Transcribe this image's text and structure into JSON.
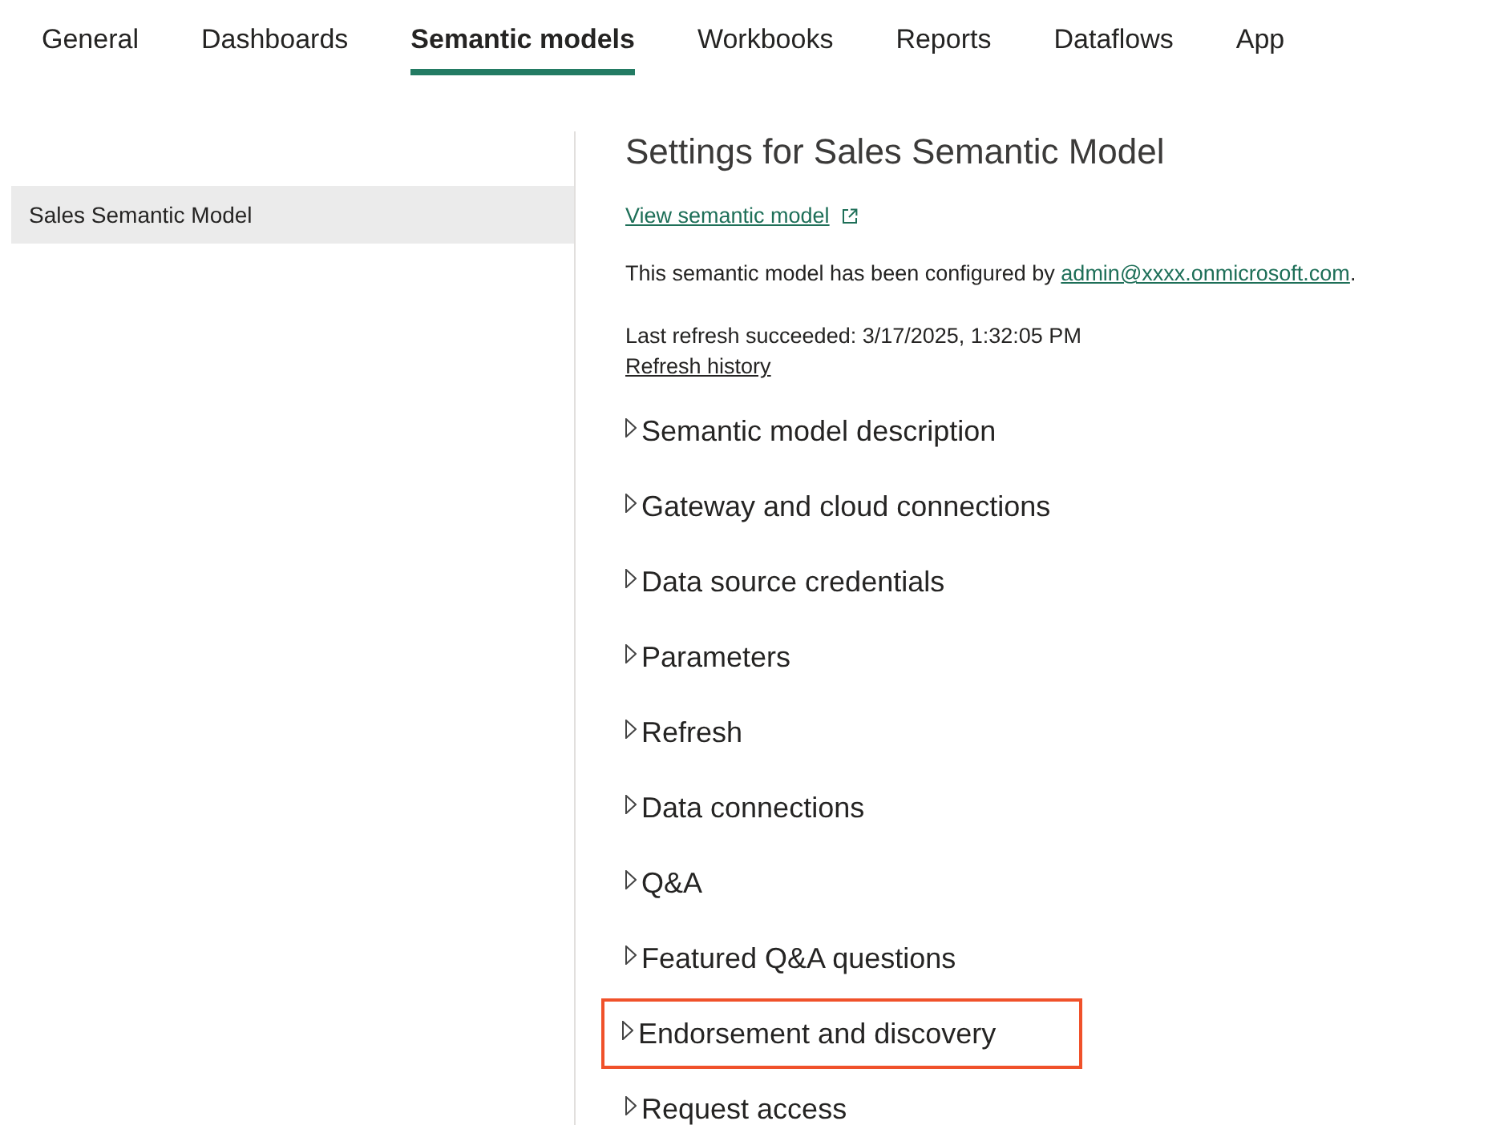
{
  "tabs": [
    {
      "label": "General",
      "selected": false
    },
    {
      "label": "Dashboards",
      "selected": false
    },
    {
      "label": "Semantic models",
      "selected": true
    },
    {
      "label": "Workbooks",
      "selected": false
    },
    {
      "label": "Reports",
      "selected": false
    },
    {
      "label": "Dataflows",
      "selected": false
    },
    {
      "label": "App",
      "selected": false
    }
  ],
  "sidebar": {
    "items": [
      {
        "label": "Sales Semantic Model",
        "selected": true
      }
    ]
  },
  "settings": {
    "title": "Settings for Sales Semantic Model",
    "view_link": "View semantic model",
    "configured_by": {
      "text": "This semantic model has been configured by",
      "email": "admin@xxxx.onmicrosoft.com",
      "suffix": "."
    },
    "last_refresh": "Last refresh succeeded: 3/17/2025, 1:32:05 PM",
    "refresh_history_link": "Refresh history",
    "sections": [
      {
        "label": "Semantic model description",
        "expanded": false,
        "highlighted": false
      },
      {
        "label": "Gateway and cloud connections",
        "expanded": false,
        "highlighted": false
      },
      {
        "label": "Data source credentials",
        "expanded": false,
        "highlighted": false
      },
      {
        "label": "Parameters",
        "expanded": false,
        "highlighted": false
      },
      {
        "label": "Refresh",
        "expanded": false,
        "highlighted": false
      },
      {
        "label": "Data connections",
        "expanded": false,
        "highlighted": false
      },
      {
        "label": "Q&A",
        "expanded": false,
        "highlighted": false
      },
      {
        "label": "Featured Q&A questions",
        "expanded": false,
        "highlighted": false
      },
      {
        "label": "Endorsement and discovery",
        "expanded": false,
        "highlighted": true
      },
      {
        "label": "Request access",
        "expanded": false,
        "highlighted": false
      }
    ]
  }
}
